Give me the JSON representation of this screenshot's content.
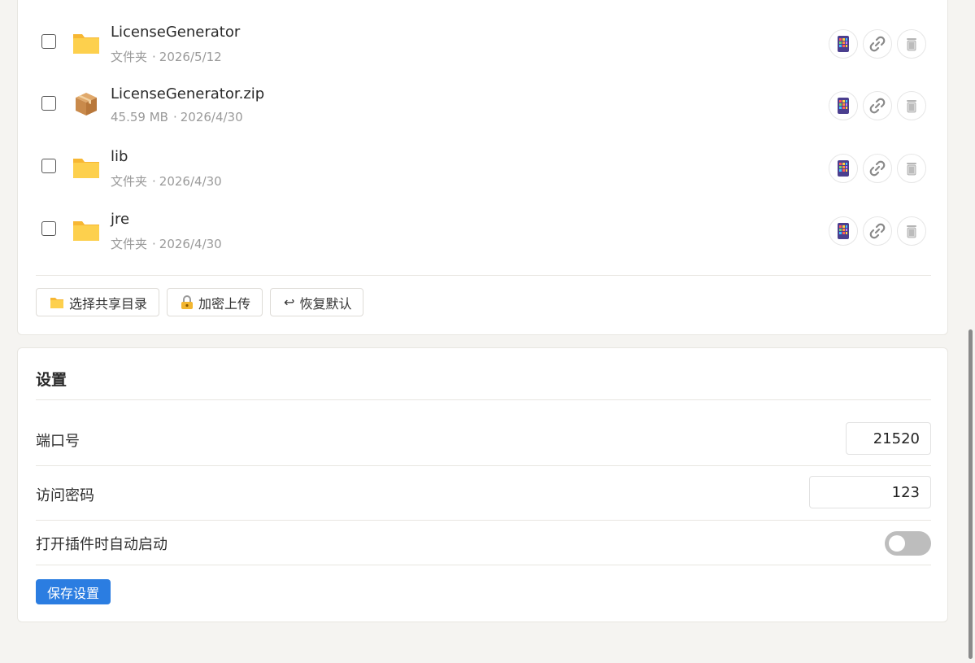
{
  "files": [
    {
      "name": "LicenseGenerator",
      "type": "folder",
      "kind_label": "文件夹",
      "date": "2026/5/12"
    },
    {
      "name": "LicenseGenerator.zip",
      "type": "archive",
      "size": "45.59 MB",
      "date": "2026/4/30"
    },
    {
      "name": "lib",
      "type": "folder",
      "kind_label": "文件夹",
      "date": "2026/4/30"
    },
    {
      "name": "jre",
      "type": "folder",
      "kind_label": "文件夹",
      "date": "2026/4/30"
    }
  ],
  "meta_separator": "·",
  "row_actions": [
    "mobile-phone-icon",
    "link-icon",
    "trash-icon"
  ],
  "buttons": {
    "select_dir": "选择共享目录",
    "encrypted_upload": "加密上传",
    "restore_default": "恢复默认",
    "restore_symbol": "↩"
  },
  "settings": {
    "title": "设置",
    "port_label": "端口号",
    "port_value": "21520",
    "password_label": "访问密码",
    "password_value": "123",
    "autostart_label": "打开插件时自动启动",
    "autostart_enabled": false,
    "save_label": "保存设置"
  },
  "colors": {
    "primary": "#2b7de1",
    "folder": "#f9c74f",
    "toggle_off": "#bdbdbd"
  }
}
